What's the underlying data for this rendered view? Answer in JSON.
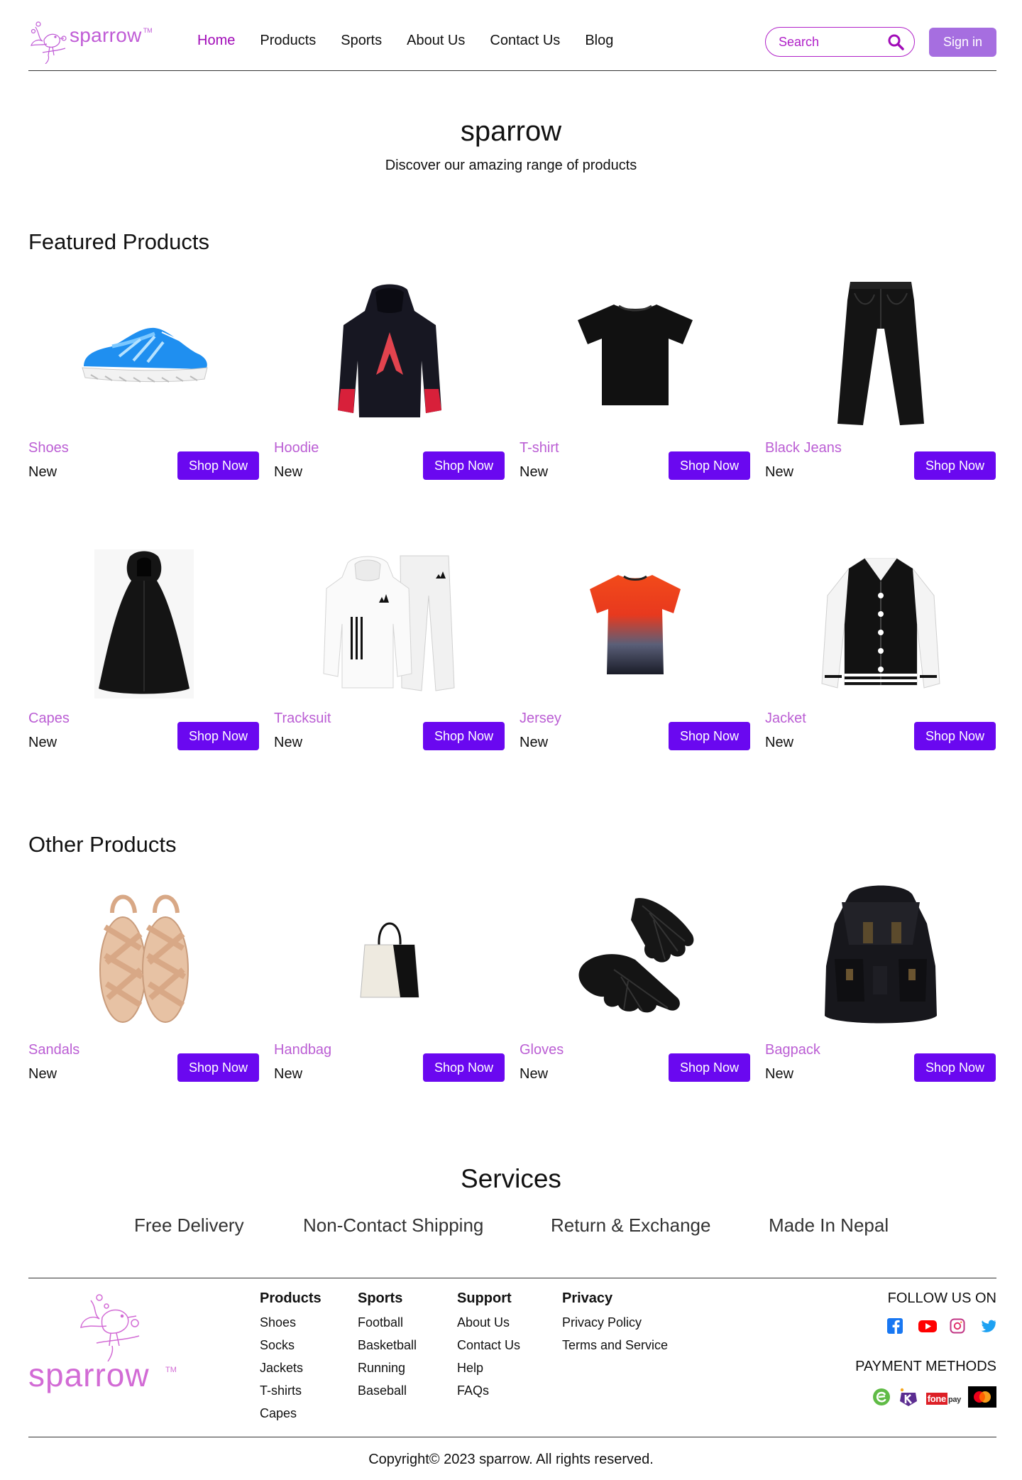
{
  "brand": {
    "name": "sparrow",
    "tm": "TM"
  },
  "nav": {
    "items": [
      {
        "label": "Home",
        "active": true
      },
      {
        "label": "Products",
        "active": false
      },
      {
        "label": "Sports",
        "active": false
      },
      {
        "label": "About Us",
        "active": false
      },
      {
        "label": "Contact Us",
        "active": false
      },
      {
        "label": "Blog",
        "active": false
      }
    ],
    "search_placeholder": "Search",
    "signin_label": "Sign in"
  },
  "hero": {
    "title": "sparrow",
    "subtitle": "Discover our amazing range of products"
  },
  "featured": {
    "title": "Featured Products",
    "products": [
      {
        "name": "Shoes",
        "tag": "New",
        "button": "Shop Now",
        "icon": "shoe-image"
      },
      {
        "name": "Hoodie",
        "tag": "New",
        "button": "Shop Now",
        "icon": "hoodie-image"
      },
      {
        "name": "T-shirt",
        "tag": "New",
        "button": "Shop Now",
        "icon": "tshirt-image"
      },
      {
        "name": "Black Jeans",
        "tag": "New",
        "button": "Shop Now",
        "icon": "jeans-image"
      },
      {
        "name": "Capes",
        "tag": "New",
        "button": "Shop Now",
        "icon": "cape-image"
      },
      {
        "name": "Tracksuit",
        "tag": "New",
        "button": "Shop Now",
        "icon": "tracksuit-image"
      },
      {
        "name": "Jersey",
        "tag": "New",
        "button": "Shop Now",
        "icon": "jersey-image"
      },
      {
        "name": "Jacket",
        "tag": "New",
        "button": "Shop Now",
        "icon": "jacket-image"
      }
    ]
  },
  "other": {
    "title": "Other Products",
    "products": [
      {
        "name": "Sandals",
        "tag": "New",
        "button": "Shop Now",
        "icon": "sandals-image"
      },
      {
        "name": "Handbag",
        "tag": "New",
        "button": "Shop Now",
        "icon": "handbag-image"
      },
      {
        "name": "Gloves",
        "tag": "New",
        "button": "Shop Now",
        "icon": "gloves-image"
      },
      {
        "name": "Bagpack",
        "tag": "New",
        "button": "Shop Now",
        "icon": "backpack-image"
      }
    ]
  },
  "services": {
    "title": "Services",
    "items": [
      "Free Delivery",
      "Non-Contact Shipping",
      "Return & Exchange",
      "Made In Nepal"
    ]
  },
  "footer": {
    "columns": [
      {
        "title": "Products",
        "links": [
          "Shoes",
          "Socks",
          "Jackets",
          "T-shirts",
          "Capes"
        ]
      },
      {
        "title": "Sports",
        "links": [
          "Football",
          "Basketball",
          "Running",
          "Baseball"
        ]
      },
      {
        "title": "Support",
        "links": [
          "About Us",
          "Contact Us",
          "Help",
          "FAQs"
        ]
      },
      {
        "title": "Privacy",
        "links": [
          "Privacy Policy",
          "Terms and Service"
        ]
      }
    ],
    "follow_title": "FOLLOW US ON",
    "social_icons": [
      "facebook-icon",
      "youtube-icon",
      "instagram-icon",
      "twitter-icon"
    ],
    "payment_title": "PAYMENT METHODS",
    "payment_icons": [
      "esewa-icon",
      "khalti-icon",
      "fonepay-icon",
      "mastercard-icon"
    ],
    "fonepay_label": "fone",
    "fonepay_suffix": "pay",
    "copyright": "Copyright© 2023 sparrow. All rights reserved."
  },
  "colors": {
    "accent": "#a10cb8",
    "product_name": "#bb5ed4",
    "shop_button": "#6a08f0",
    "signin_button": "#a66ee0"
  }
}
